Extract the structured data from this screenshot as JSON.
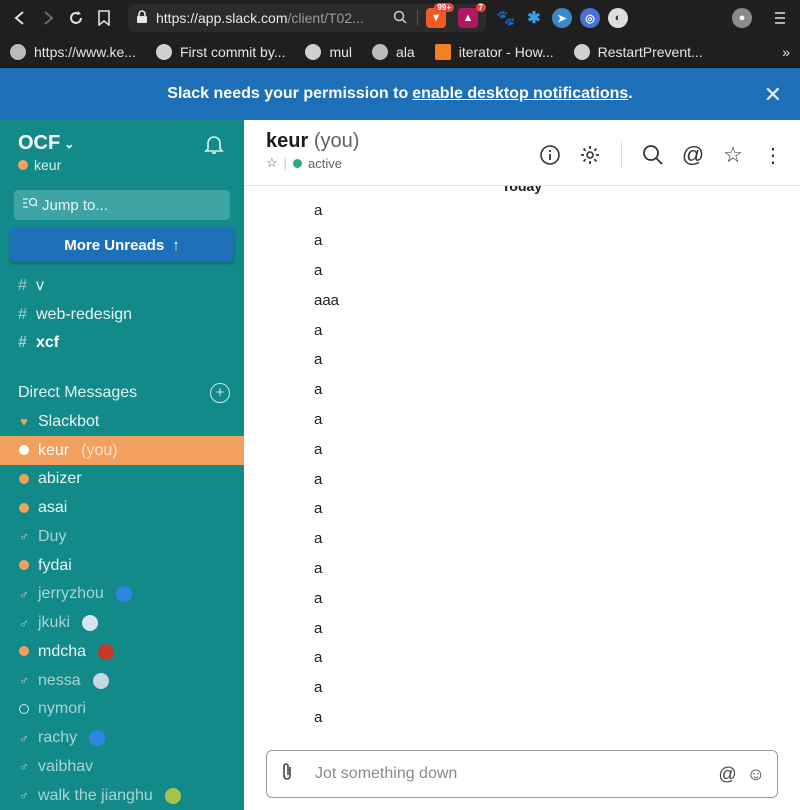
{
  "browser": {
    "url_main": "https://app.slack.com",
    "url_rest": "/client/T02...",
    "extensions": [
      {
        "name": "brave-shield-icon",
        "color": "#f15a24",
        "badge": "99+"
      },
      {
        "name": "brave-rewards-icon",
        "color": "#b3175f",
        "badge": "7"
      }
    ],
    "bookmarks": [
      {
        "label": "https://www.ke...",
        "icon": "globe-icon"
      },
      {
        "label": "First commit by...",
        "icon": "github-icon"
      },
      {
        "label": "mul",
        "icon": "github-icon"
      },
      {
        "label": "ala",
        "icon": "globe-icon"
      },
      {
        "label": "iterator - How...",
        "icon": "stackoverflow-icon"
      },
      {
        "label": "RestartPrevent...",
        "icon": "github-icon"
      }
    ],
    "more_label": "»"
  },
  "banner": {
    "text": "Slack needs your permission to",
    "link": "enable desktop notifications",
    "suffix": "."
  },
  "sidebar": {
    "workspace": "OCF",
    "current_user": "keur",
    "jump_placeholder": "Jump to...",
    "more_unreads": "More Unreads",
    "channels": [
      {
        "name": "v",
        "bold": false
      },
      {
        "name": "web-redesign",
        "bold": false
      },
      {
        "name": "xcf",
        "bold": true
      }
    ],
    "dm_header": "Direct Messages",
    "dms": [
      {
        "name": "Slackbot",
        "status": "heart"
      },
      {
        "name": "keur",
        "status": "online",
        "you": "(you)",
        "active": true
      },
      {
        "name": "abizer",
        "status": "online"
      },
      {
        "name": "asai",
        "status": "online"
      },
      {
        "name": "Duy",
        "status": "away"
      },
      {
        "name": "fydai",
        "status": "online"
      },
      {
        "name": "jerryzhou",
        "status": "away",
        "emoji": "#2f86e0"
      },
      {
        "name": "jkuki",
        "status": "away",
        "emoji": "#d8e4f0"
      },
      {
        "name": "mdcha",
        "status": "online",
        "emoji": "#c0392b"
      },
      {
        "name": "nessa",
        "status": "away",
        "emoji": "#c9d6e3"
      },
      {
        "name": "nymori",
        "status": "hollow"
      },
      {
        "name": "rachy",
        "status": "away",
        "emoji": "#2f86e0"
      },
      {
        "name": "vaibhav",
        "status": "away"
      },
      {
        "name": "walk the jianghu",
        "status": "away",
        "emoji": "#a7c44a"
      }
    ]
  },
  "channel": {
    "name": "keur",
    "you": "(you)",
    "presence": "active",
    "day_divider": "Today"
  },
  "messages": [
    "a",
    "a",
    "a",
    "aaa",
    "a",
    "a",
    "a",
    "a",
    "a",
    "a",
    "a",
    "a",
    "a",
    "a",
    "a",
    "a",
    "a",
    "a"
  ],
  "composer": {
    "placeholder": "Jot something down"
  }
}
